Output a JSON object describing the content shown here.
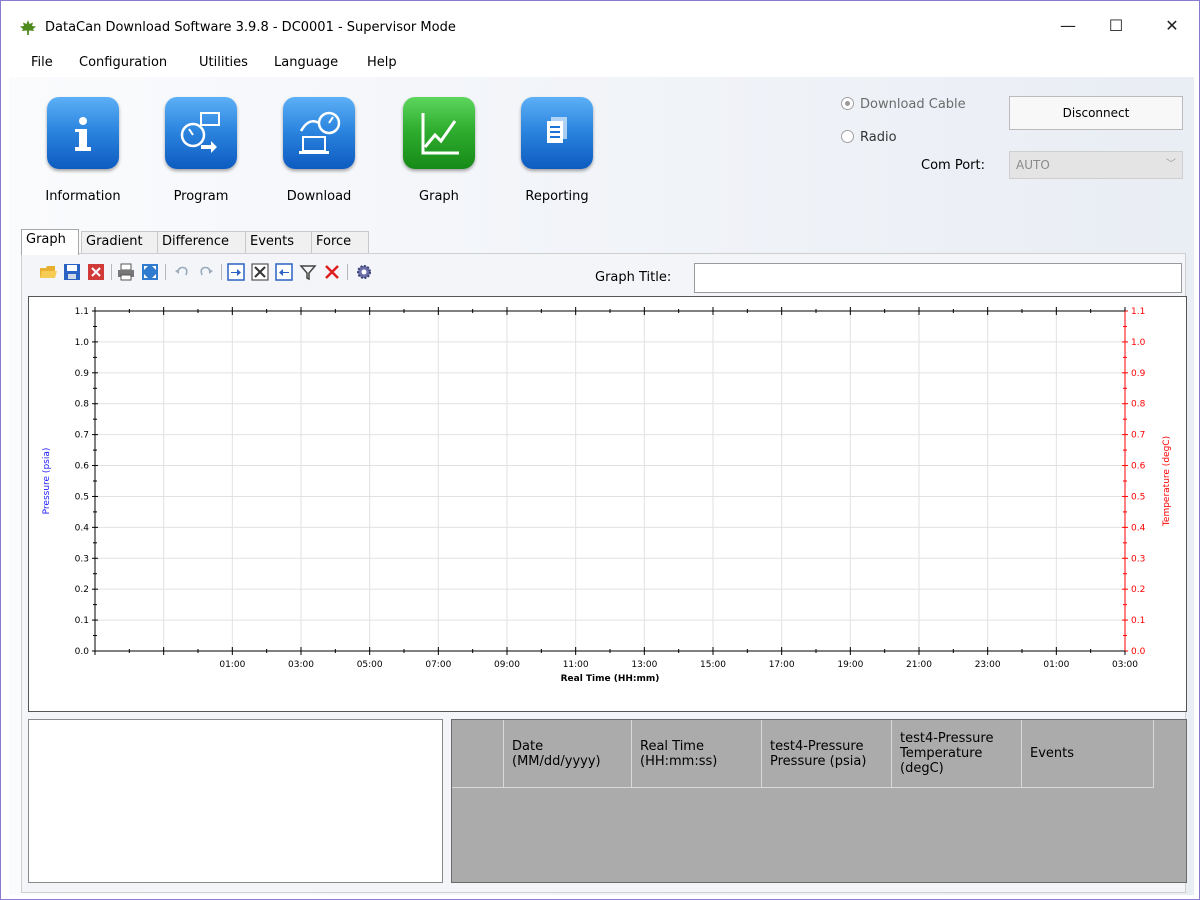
{
  "window": {
    "title": "DataCan Download Software 3.9.8 - DC0001 - Supervisor Mode",
    "minimize": "—",
    "maximize": "☐",
    "close": "✕"
  },
  "menu": [
    "File",
    "Configuration",
    "Utilities",
    "Language",
    "Help"
  ],
  "main_buttons": [
    {
      "label": "Information",
      "icon": "info-icon",
      "color": "#1e73d6"
    },
    {
      "label": "Program",
      "icon": "program-icon",
      "color": "#1e73d6"
    },
    {
      "label": "Download",
      "icon": "download-icon",
      "color": "#1e73d6"
    },
    {
      "label": "Graph",
      "icon": "graph-icon",
      "color": "#2aa52a"
    },
    {
      "label": "Reporting",
      "icon": "reporting-icon",
      "color": "#1e73d6"
    }
  ],
  "connection": {
    "download_cable_label": "Download Cable",
    "download_cable_selected": true,
    "radio_label": "Radio",
    "radio_selected": false,
    "disconnect_label": "Disconnect",
    "com_port_label": "Com Port:",
    "com_port_value": "AUTO"
  },
  "tabs": [
    {
      "label": "Graph",
      "active": true
    },
    {
      "label": "Gradient",
      "active": false
    },
    {
      "label": "Difference",
      "active": false
    },
    {
      "label": "Events",
      "active": false
    },
    {
      "label": "Force",
      "active": false
    }
  ],
  "toolbar": {
    "icons": [
      "open-folder-icon",
      "save-icon",
      "close-file-icon",
      "print-icon",
      "zoom-fit-icon",
      "undo-icon",
      "redo-icon",
      "import-icon",
      "delete-column-icon",
      "export-icon",
      "filter-icon",
      "clear-icon",
      "settings-icon"
    ],
    "graph_title_label": "Graph Title:",
    "graph_title_value": ""
  },
  "chart_data": {
    "type": "line",
    "xlabel": "Real Time (HH:mm)",
    "ylabel": "Pressure (psia)",
    "y2label": "Temperature (degC)",
    "ylim": [
      0.0,
      1.1
    ],
    "y2lim": [
      0.0,
      1.1
    ],
    "yticks": [
      "0.0",
      "0.1",
      "0.2",
      "0.3",
      "0.4",
      "0.5",
      "0.6",
      "0.7",
      "0.8",
      "0.9",
      "1.0",
      "1.1"
    ],
    "y2ticks": [
      "0.0",
      "0.1",
      "0.2",
      "0.3",
      "0.4",
      "0.5",
      "0.6",
      "0.7",
      "0.8",
      "0.9",
      "1.0",
      "1.1"
    ],
    "xticks": [
      "01:00",
      "03:00",
      "05:00",
      "07:00",
      "09:00",
      "11:00",
      "13:00",
      "15:00",
      "17:00",
      "19:00",
      "21:00",
      "23:00",
      "01:00",
      "03:00"
    ],
    "series": [],
    "grid": true,
    "ylabel_color": "#1a1aff",
    "y2label_color": "#ff0000"
  },
  "data_grid": {
    "columns": [
      "",
      "Date\n(MM/dd/yyyy)",
      "Real Time\n(HH:mm:ss)",
      "test4-Pressure\nPressure (psia)",
      "test4-Pressure\nTemperature\n(degC)",
      "Events"
    ],
    "rows": []
  }
}
